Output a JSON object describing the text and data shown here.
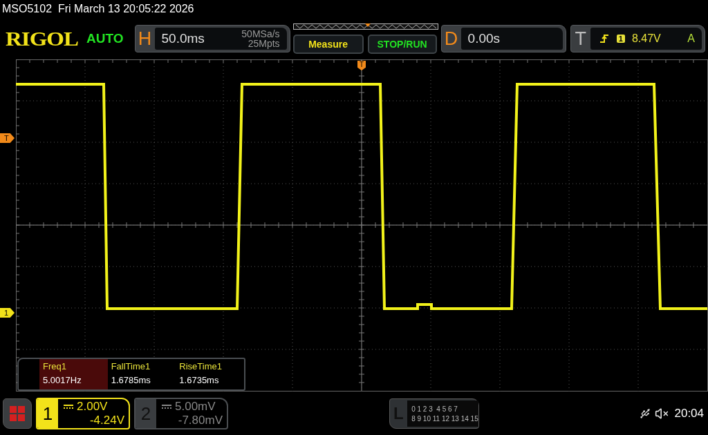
{
  "status_line": "MSO5102  Fri March 13 20:05:22 2026",
  "header": {
    "logo": "RIGOL",
    "trigger_status": "AUTO",
    "horizontal": {
      "label": "H",
      "timebase": "50.0ms",
      "sample_rate": "50MSa/s",
      "memory_depth": "25Mpts"
    },
    "buttons": [
      "Measure",
      "STOP/RUN"
    ],
    "delay": {
      "label": "D",
      "value": "0.00s"
    },
    "trigger": {
      "label": "T",
      "source": "1",
      "level": "8.47V",
      "mode": "A"
    }
  },
  "trigger_position_marker": "T",
  "markers": [
    {
      "label": "T",
      "kind": "trigger"
    },
    {
      "label": "1",
      "kind": "channel"
    }
  ],
  "measurements": [
    {
      "name": "Freq1",
      "value": "5.0017Hz",
      "selected": true
    },
    {
      "name": "FallTime1",
      "value": "1.6785ms",
      "selected": false
    },
    {
      "name": "RiseTime1",
      "value": "1.6735ms",
      "selected": false
    }
  ],
  "channels": [
    {
      "number": "1",
      "scale": "2.00V",
      "offset": "-4.24V",
      "selected": true
    },
    {
      "number": "2",
      "scale": "5.00mV",
      "offset": "-7.80mV",
      "selected": false
    }
  ],
  "logic": {
    "label": "L",
    "rows": [
      "0 1 2 3  4 5 6 7",
      "8 9 10 11 12 13 14 15"
    ]
  },
  "clock": "20:04"
}
